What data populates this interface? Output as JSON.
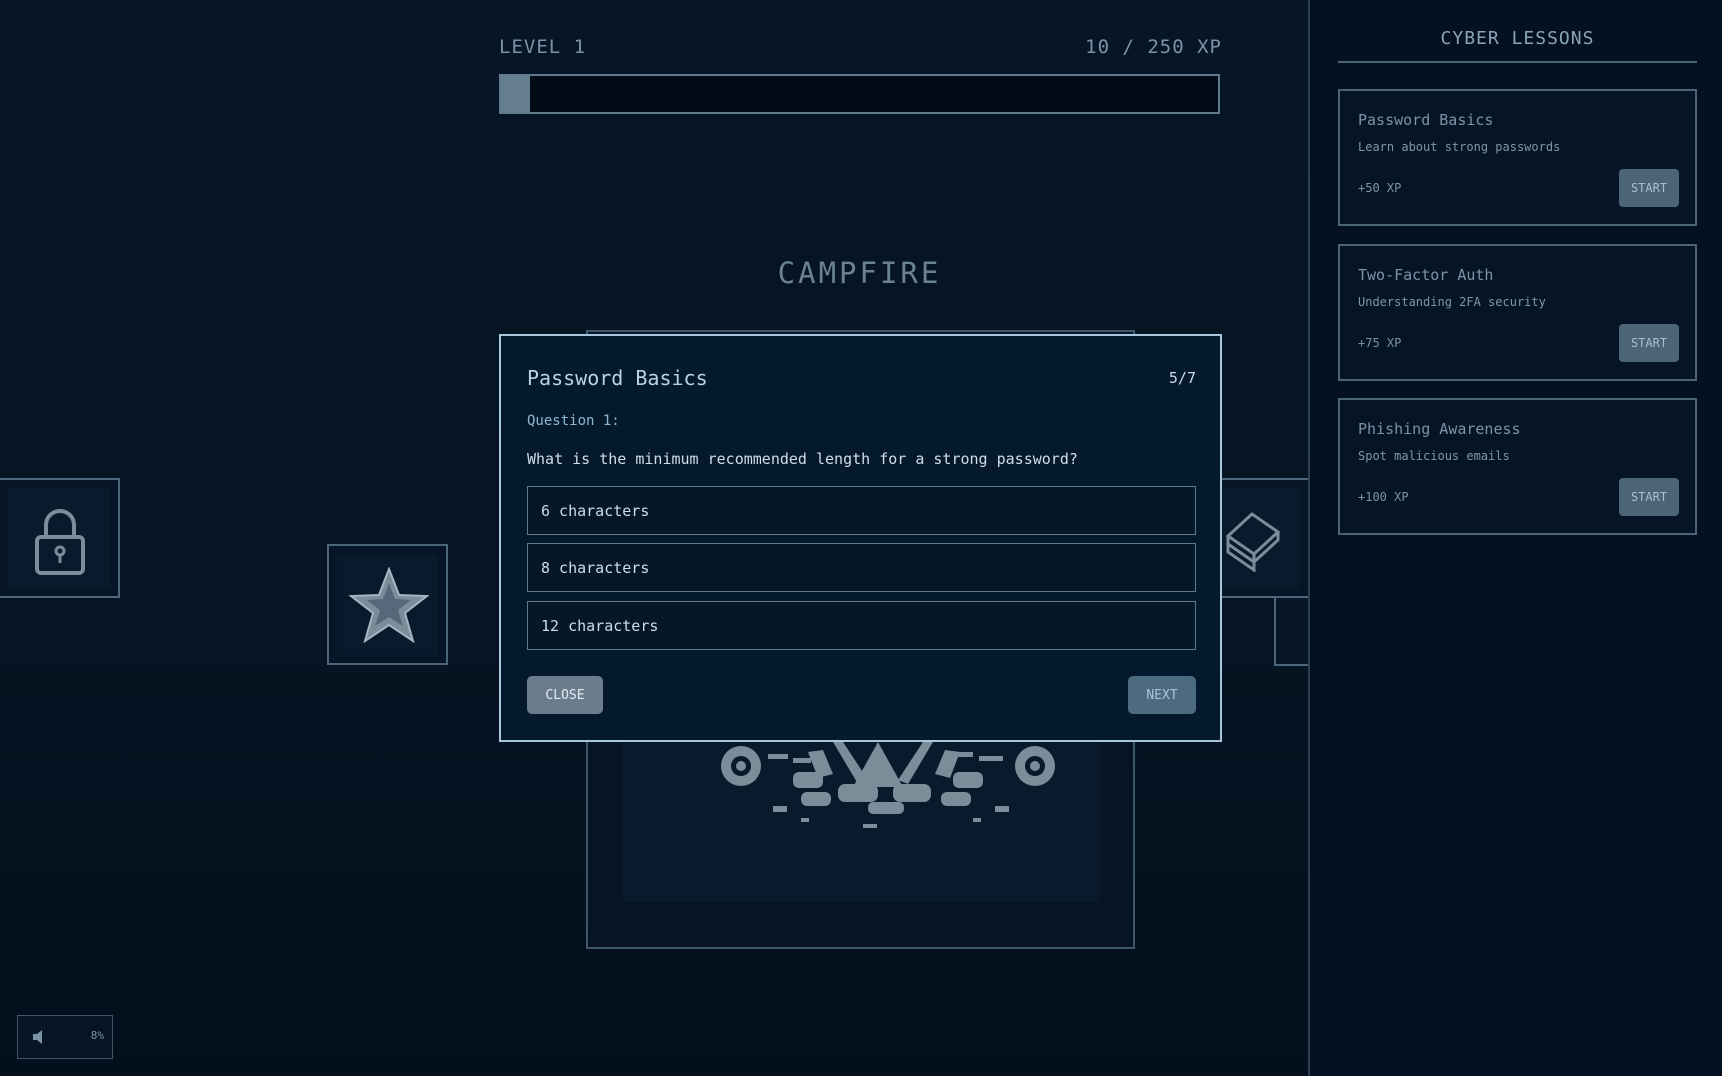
{
  "hud": {
    "level_label": "LEVEL 1",
    "xp_text": "10 / 250 XP",
    "xp_progress": 0.04
  },
  "scene": {
    "location_title": "CAMPFIRE"
  },
  "sidebar": {
    "title": "CYBER LESSONS",
    "lessons": [
      {
        "name": "Password Basics",
        "desc": "Learn about strong passwords",
        "xp": "+50 XP",
        "button": "START"
      },
      {
        "name": "Two-Factor Auth",
        "desc": "Understanding 2FA security",
        "xp": "+75 XP",
        "button": "START"
      },
      {
        "name": "Phishing Awareness",
        "desc": "Spot malicious emails",
        "xp": "+100 XP",
        "button": "START"
      }
    ]
  },
  "sound": {
    "icon": "speaker-icon",
    "volume": "8%"
  },
  "quiz": {
    "title": "Password Basics",
    "progress": "5/7",
    "question_number": "Question 1:",
    "question": "What is the minimum recommended length for a strong password?",
    "options": [
      "6 characters",
      "8 characters",
      "12 characters"
    ],
    "close_label": "CLOSE",
    "next_label": "NEXT"
  },
  "icons": {
    "lock": "lock-icon",
    "star": "star-icon",
    "book": "book-stack-icon",
    "campfire": "campfire-sprite"
  }
}
